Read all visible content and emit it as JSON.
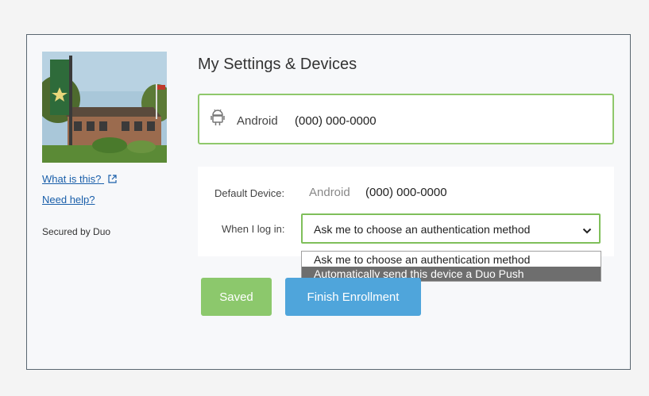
{
  "sidebar": {
    "what_is_this": "What is this?",
    "need_help": "Need help?",
    "secured_by": "Secured by Duo"
  },
  "main": {
    "title": "My Settings & Devices",
    "device": {
      "icon": "android-icon",
      "name": "Android",
      "phone": "(000) 000-0000"
    },
    "settings": {
      "default_device_label": "Default Device:",
      "default_device_name": "Android",
      "default_device_phone": "(000) 000-0000",
      "login_label": "When I log in:",
      "login_selected": "Ask me to choose an authentication method",
      "login_options": [
        "Ask me to choose an authentication method",
        "Automatically send this device a Duo Push"
      ],
      "highlighted_option_index": 1
    },
    "buttons": {
      "saved": "Saved",
      "finish": "Finish Enrollment"
    }
  },
  "colors": {
    "accent_green": "#8cc86c",
    "accent_blue": "#4fa5db",
    "link": "#1a5faa"
  }
}
